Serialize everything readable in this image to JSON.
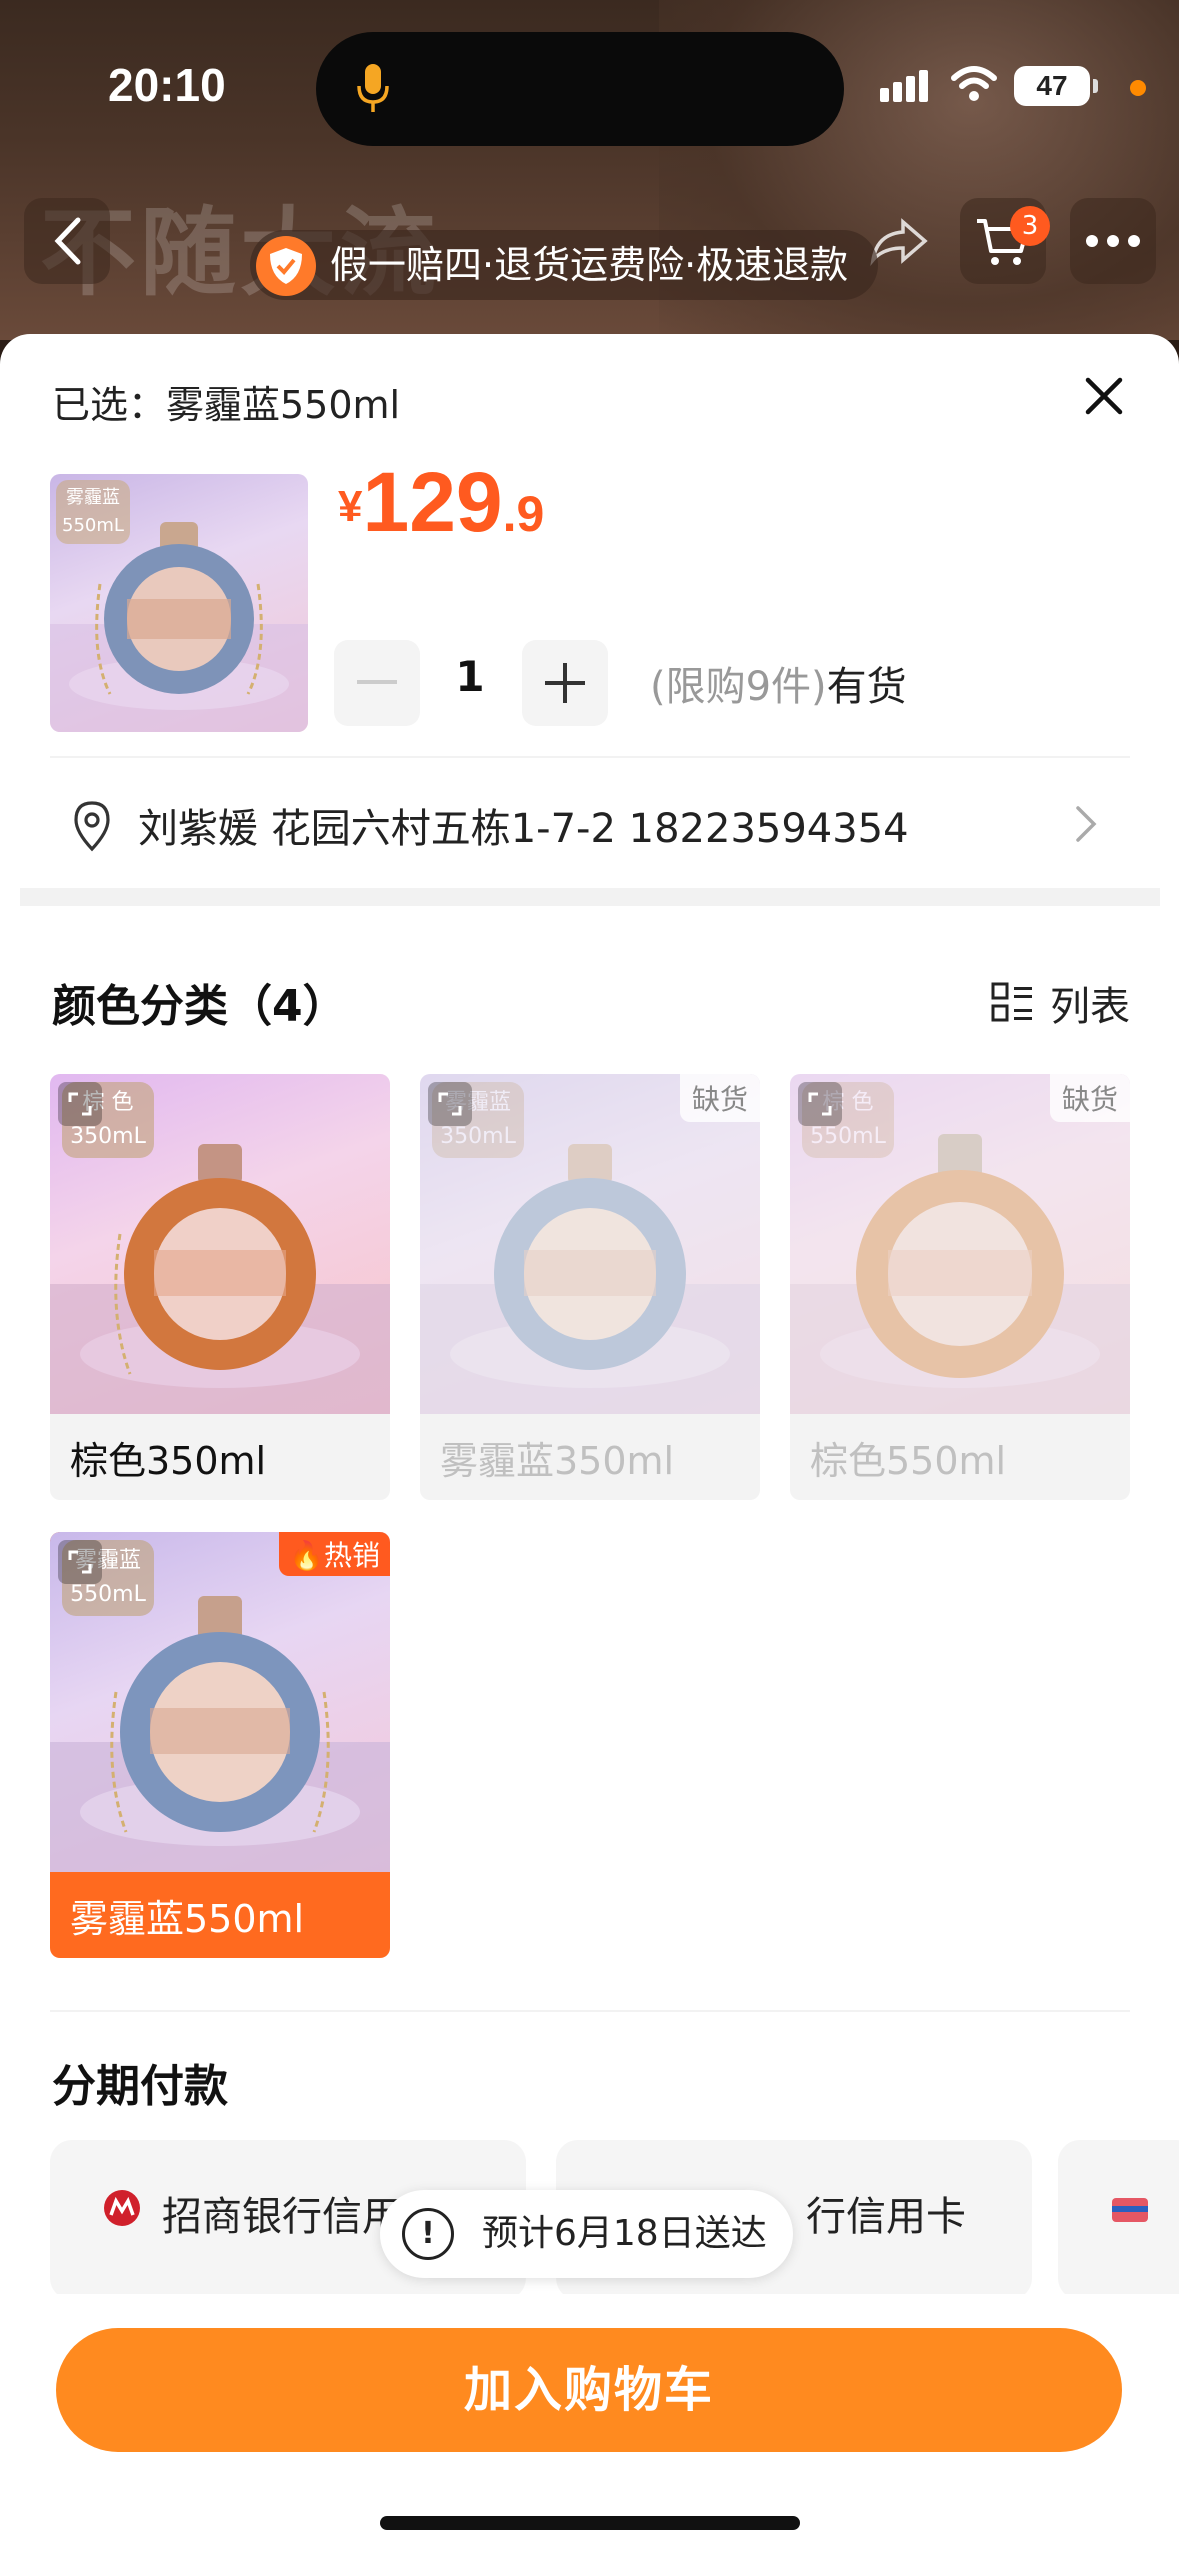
{
  "status_bar": {
    "time": "20:10",
    "battery": "47"
  },
  "header": {
    "ghost_title": "不随大流",
    "cart_count": "3",
    "guarantee": "假一赔四·退货运费险·极速退款"
  },
  "sku": {
    "selected_text": "已选：雾霾蓝550ml",
    "thumb_tag_line1": "雾霾蓝",
    "thumb_tag_line2": "550mL",
    "currency": "¥",
    "price_int": "129",
    "price_dec": ".9",
    "quantity": "1",
    "limit_text": "(限购9件)",
    "stock_text": "有货"
  },
  "address": {
    "text": "刘紫媛 花园六村五栋1-7-2 18223594354"
  },
  "colors": {
    "title": "颜色分类（4）",
    "list_toggle": "列表",
    "options": [
      {
        "label": "棕色350ml",
        "tag1": "棕 色",
        "tag2": "350mL",
        "status": "",
        "badge": ""
      },
      {
        "label": "雾霾蓝350ml",
        "tag1": "雾霾蓝",
        "tag2": "350mL",
        "status": "缺货",
        "badge": ""
      },
      {
        "label": "棕色550ml",
        "tag1": "棕 色",
        "tag2": "550mL",
        "status": "缺货",
        "badge": ""
      },
      {
        "label": "雾霾蓝550ml",
        "tag1": "雾霾蓝",
        "tag2": "550mL",
        "status": "",
        "badge": "热销"
      }
    ]
  },
  "installment": {
    "title": "分期付款",
    "banks": [
      "招商银行信用卡",
      "行信用卡"
    ]
  },
  "eta": {
    "text": "预计6月18日送达"
  },
  "cta": {
    "add_to_cart": "加入购物车"
  },
  "theme": {
    "accent": "#ff5a1f",
    "button": "#ff8a1f"
  }
}
